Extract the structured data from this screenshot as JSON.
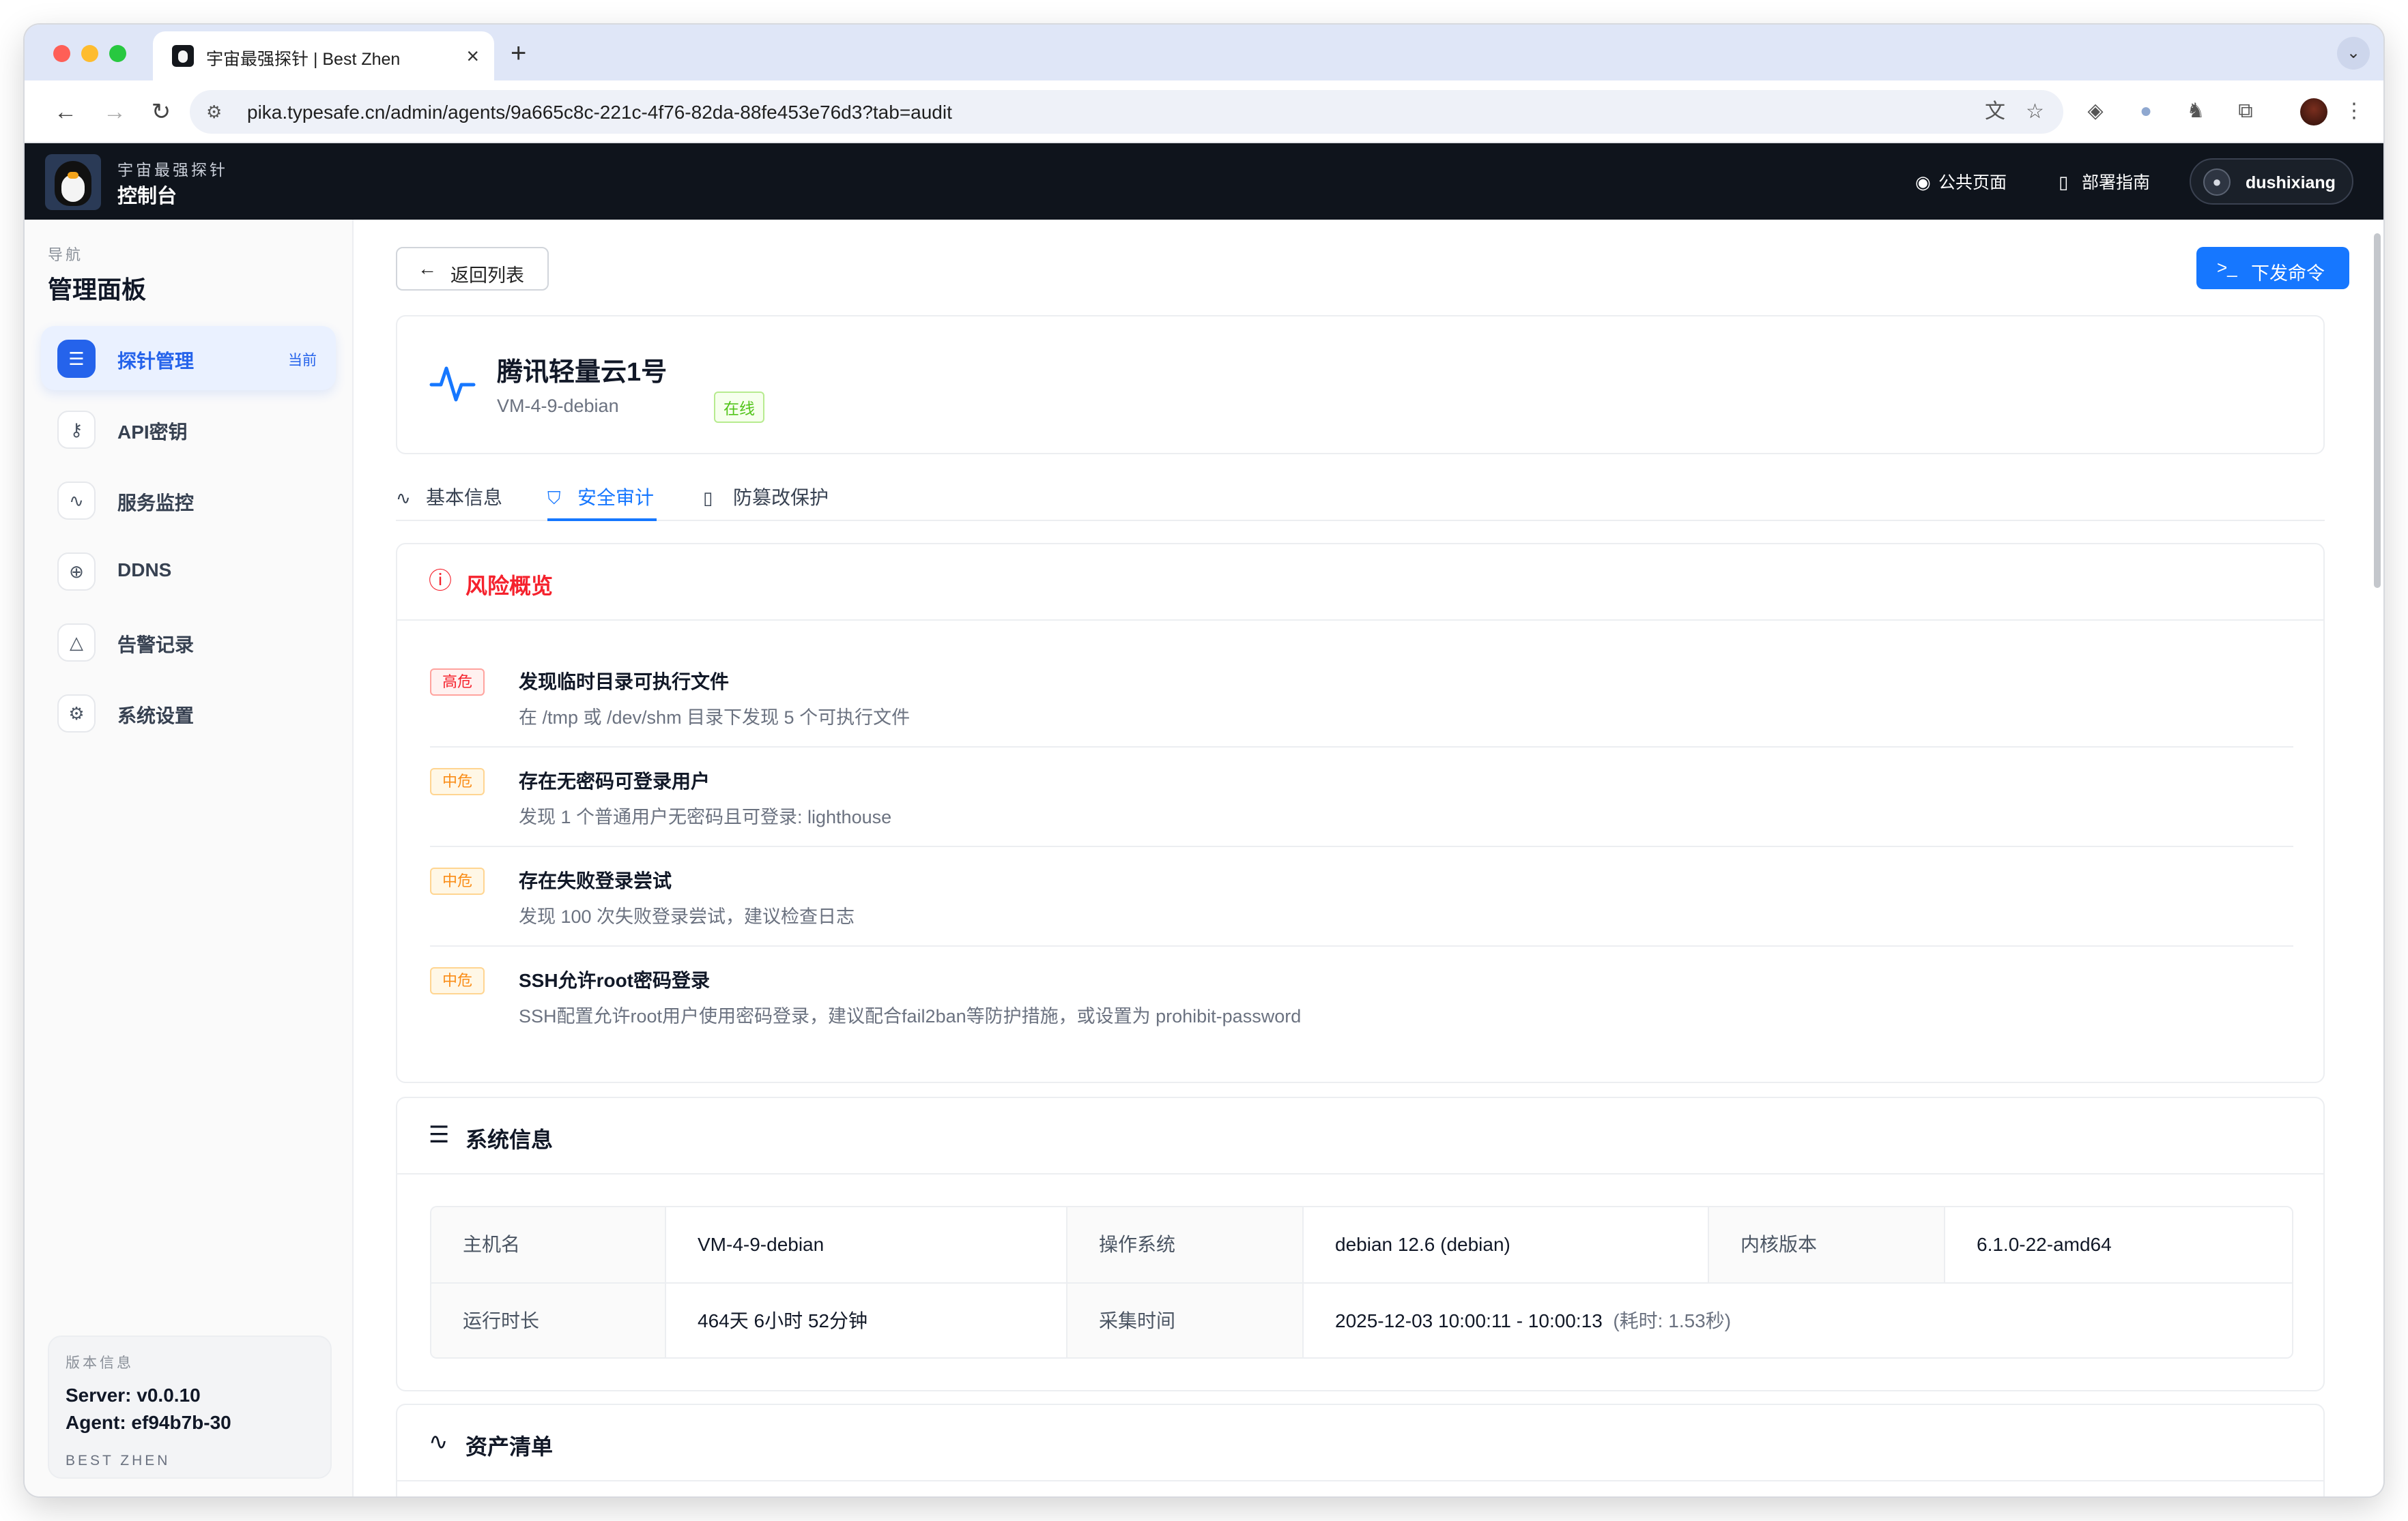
{
  "browser": {
    "tab_title": "宇宙最强探针 | Best Zhen",
    "tab_close": "×",
    "new_tab": "+",
    "tab_menu": "⌄",
    "url": "pika.typesafe.cn/admin/agents/9a665c8c-221c-4f76-82da-88fe453e76d3?tab=audit"
  },
  "header": {
    "brand_sub": "宇宙最强探针",
    "brand_title": "控制台",
    "public_page": "公共页面",
    "deploy_guide": "部署指南",
    "username": "dushixiang"
  },
  "sidebar": {
    "caption": "导航",
    "title": "管理面板",
    "items": [
      {
        "label": "探针管理",
        "badge": "当前",
        "icon": "server-icon"
      },
      {
        "label": "API密钥",
        "icon": "key-icon"
      },
      {
        "label": "服务监控",
        "icon": "activity-icon"
      },
      {
        "label": "DDNS",
        "icon": "globe-icon"
      },
      {
        "label": "告警记录",
        "icon": "warning-icon"
      },
      {
        "label": "系统设置",
        "icon": "gear-icon"
      }
    ],
    "version": {
      "caption": "版本信息",
      "server": "Server: v0.0.10",
      "agent": "Agent: ef94b7b-30",
      "footer": "BEST ZHEN"
    }
  },
  "main": {
    "back_label": "返回列表",
    "command_label": "下发命令",
    "agent": {
      "name": "腾讯轻量云1号",
      "hostname": "VM-4-9-debian",
      "status": "在线"
    },
    "tabs": [
      {
        "label": "基本信息",
        "icon": "activity-icon"
      },
      {
        "label": "安全审计",
        "icon": "shield-icon"
      },
      {
        "label": "防篡改保护",
        "icon": "file-icon"
      }
    ],
    "risk_panel": {
      "title": "风险概览",
      "items": [
        {
          "level": "高危",
          "title": "发现临时目录可执行文件",
          "desc": "在 /tmp 或 /dev/shm 目录下发现 5 个可执行文件"
        },
        {
          "level": "中危",
          "title": "存在无密码可登录用户",
          "desc": "发现 1 个普通用户无密码且可登录: lighthouse"
        },
        {
          "level": "中危",
          "title": "存在失败登录尝试",
          "desc": "发现 100 次失败登录尝试，建议检查日志"
        },
        {
          "level": "中危",
          "title": "SSH允许root密码登录",
          "desc": "SSH配置允许root用户使用密码登录，建议配合fail2ban等防护措施，或设置为 prohibit-password"
        }
      ]
    },
    "sysinfo_panel": {
      "title": "系统信息",
      "hostname_key": "主机名",
      "hostname_val": "VM-4-9-debian",
      "os_key": "操作系统",
      "os_val": "debian 12.6 (debian)",
      "kernel_key": "内核版本",
      "kernel_val": "6.1.0-22-amd64",
      "uptime_key": "运行时长",
      "uptime_val": "464天 6小时 52分钟",
      "collect_key": "采集时间",
      "collect_val": "2025-12-03 10:00:11 - 10:00:13",
      "collect_cost": "(耗时: 1.53秒)"
    },
    "assets_panel": {
      "title": "资产清单"
    }
  },
  "colors": {
    "primary": "#1677ff",
    "danger": "#f5222d",
    "warning": "#fa8c16",
    "success": "#52c41a",
    "header_bg": "#0f141c"
  }
}
